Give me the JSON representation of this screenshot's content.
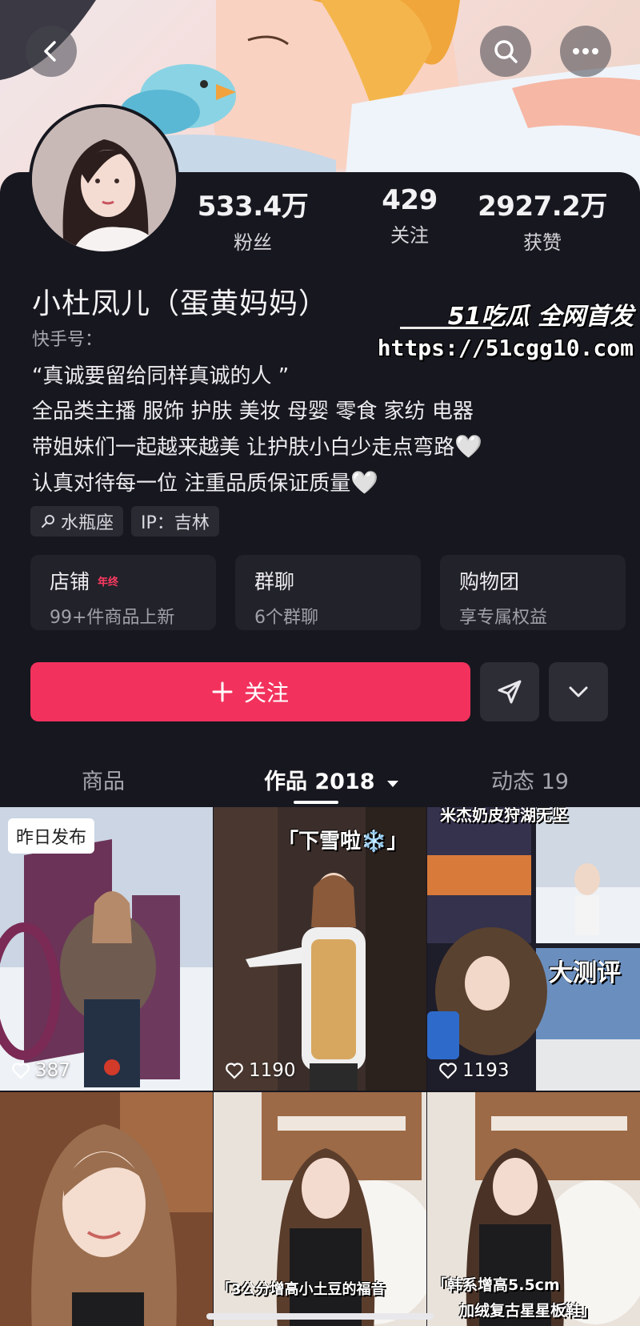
{
  "profile": {
    "name": "小杜凤儿（蛋黄妈妈）",
    "ks_id_label": "快手号：",
    "stats": [
      {
        "value": "533.4万",
        "label": "粉丝"
      },
      {
        "value": "429",
        "label": "关注"
      },
      {
        "value": "2927.2万",
        "label": "获赞"
      }
    ],
    "bio": [
      "“真诚要留给同样真诚的人 ”",
      "全品类主播 服饰 护肤 美妆 母婴 零食 家纺 电器",
      "带姐妹们一起越来越美  让护肤小白少走点弯路",
      "认真对待每一位 注重品质保证质量"
    ],
    "heart_glyph": "🤍",
    "tags": [
      {
        "icon": "zodiac-icon",
        "text": "水瓶座"
      },
      {
        "text": "IP：吉林"
      }
    ]
  },
  "watermark": {
    "top": "51吃瓜 全网首发",
    "url": "https://51cgg10.com"
  },
  "entries": [
    {
      "title": "店铺",
      "badge": "年终",
      "sub": "99+件商品上新"
    },
    {
      "title": "群聊",
      "sub": "6个群聊"
    },
    {
      "title": "购物团",
      "sub": "享专属权益"
    }
  ],
  "actions": {
    "follow_label": "关注",
    "follow_icon": "plus-icon",
    "share_icon": "send-icon",
    "more_icon": "chevron-down-icon"
  },
  "tabs": [
    {
      "label": "商品",
      "active": false
    },
    {
      "label": "作品 2018",
      "active": true
    },
    {
      "label": "动态 19",
      "active": false
    }
  ],
  "videos": [
    {
      "likes": "387",
      "label": "昨日发布"
    },
    {
      "likes": "1190",
      "caption": "「下雪啦❄️」"
    },
    {
      "likes": "1193",
      "caption_top": "米杰奶皮狩湖无坚",
      "caption": "大测评"
    },
    {
      "caption": ""
    },
    {
      "caption": "「3公分增高小土豆的福音"
    },
    {
      "caption": "「韩系增高5.5cm",
      "caption2": "加绒复古星星板鞋」"
    }
  ],
  "colors": {
    "background": "#17171f",
    "accent": "#f2325d",
    "card": "#22222a"
  }
}
